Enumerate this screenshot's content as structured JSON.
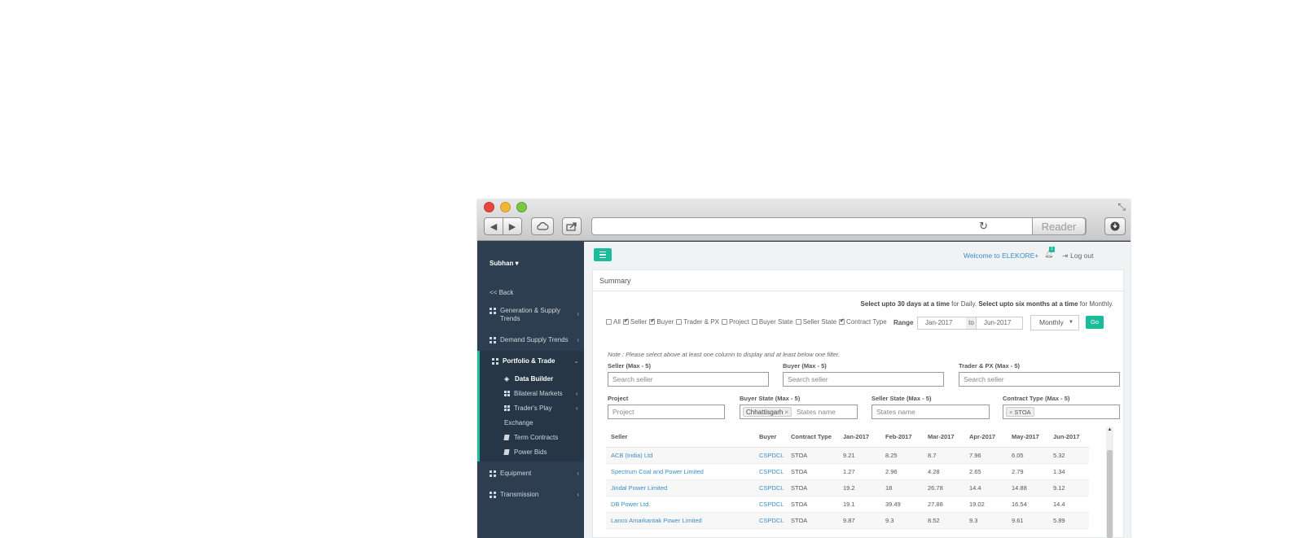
{
  "browser": {
    "reader_label": "Reader"
  },
  "sidebar": {
    "user": "Subhan",
    "back": "<< Back",
    "items": [
      {
        "label": "Generation & Supply Trends"
      },
      {
        "label": "Demand Supply Trends"
      },
      {
        "label": "Portfolio & Trade"
      },
      {
        "label": "Equipment"
      },
      {
        "label": "Transmission"
      }
    ],
    "portfolio_sub": [
      {
        "label": "Data Builder"
      },
      {
        "label": "Bilateral Markets"
      },
      {
        "label": "Trader's Play"
      },
      {
        "label": "Exchange"
      },
      {
        "label": "Term Contracts"
      },
      {
        "label": "Power Bids"
      }
    ]
  },
  "header": {
    "welcome": "Welcome to ELEKORE+",
    "notification_count": "1",
    "logout": "Log out"
  },
  "summary": {
    "title": "Summary",
    "hint_part1": "Select upto 30 days at a time",
    "hint_part2": " for Daily. ",
    "hint_part3": "Select upto six months at a time",
    "hint_part4": " for Monthly.",
    "columns": [
      {
        "label": "All",
        "checked": false
      },
      {
        "label": "Seller",
        "checked": true
      },
      {
        "label": "Buyer",
        "checked": true
      },
      {
        "label": "Trader & PX",
        "checked": false
      },
      {
        "label": "Project",
        "checked": false
      },
      {
        "label": "Buyer State",
        "checked": false
      },
      {
        "label": "Seller State",
        "checked": false
      },
      {
        "label": "Contract Type",
        "checked": true
      }
    ],
    "range_label": "Range",
    "range_from": "Jan-2017",
    "range_to_label": "to",
    "range_to": "Jun-2017",
    "period": "Monthly",
    "go": "Go",
    "note": "Note : Please select above at least one column to display and at least below one filter.",
    "filters": {
      "seller_label": "Seller (Max - 5)",
      "seller_placeholder": "Search seller",
      "buyer_label": "Buyer (Max - 5)",
      "buyer_placeholder": "Search seller",
      "trader_label": "Trader & PX (Max - 5)",
      "trader_placeholder": "Search seller",
      "project_label": "Project",
      "project_placeholder": "Project",
      "buyer_state_label": "Buyer State (Max - 5)",
      "buyer_state_tag": "Chhattisgarh",
      "buyer_state_placeholder": "States name",
      "seller_state_label": "Seller State (Max - 5)",
      "seller_state_placeholder": "States name",
      "contract_type_label": "Contract Type (Max - 5)",
      "contract_type_tag": "STOA"
    }
  },
  "table": {
    "headers": [
      "Seller",
      "Buyer",
      "Contract Type",
      "Jan-2017",
      "Feb-2017",
      "Mar-2017",
      "Apr-2017",
      "May-2017",
      "Jun-2017"
    ],
    "rows": [
      [
        "ACB (India) Ltd",
        "CSPDCL",
        "STOA",
        "9.21",
        "8.25",
        "8.7",
        "7.96",
        "6.05",
        "5.32"
      ],
      [
        "Spectrum Coal and Power Limited",
        "CSPDCL",
        "STOA",
        "1.27",
        "2.96",
        "4.28",
        "2.65",
        "2.79",
        "1.34"
      ],
      [
        "Jindal Power Limited",
        "CSPDCL",
        "STOA",
        "19.2",
        "18",
        "26.78",
        "14.4",
        "14.88",
        "9.12"
      ],
      [
        "DB Power Ltd.",
        "CSPDCL",
        "STOA",
        "19.1",
        "39.49",
        "27.88",
        "19.02",
        "16.54",
        "14.4"
      ],
      [
        "Lanco Amarkantak Power Limited",
        "CSPDCL",
        "STOA",
        "9.87",
        "9.3",
        "8.52",
        "9.3",
        "9.61",
        "5.89"
      ]
    ]
  }
}
